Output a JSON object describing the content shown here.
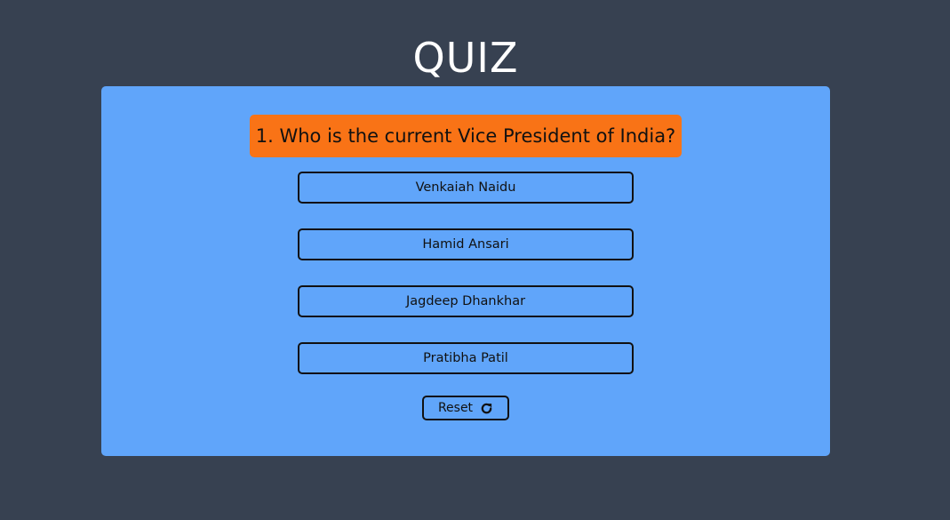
{
  "app": {
    "title": "QUIZ"
  },
  "quiz": {
    "question": "1. Who is the current Vice President of India?",
    "options": [
      "Venkaiah Naidu",
      "Hamid Ansari",
      "Jagdeep Dhankhar",
      "Pratibha Patil"
    ],
    "reset_label": "Reset",
    "reset_icon": "redo-icon"
  },
  "colors": {
    "background": "#374151",
    "card": "#60a5fa",
    "question_bg": "#f97316",
    "title_text": "#ffffff",
    "border": "#111111"
  }
}
